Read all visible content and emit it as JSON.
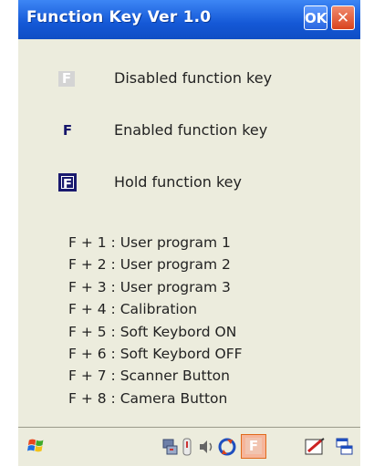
{
  "window": {
    "title": "Function Key Ver 1.0",
    "ok_label": "OK",
    "close_label": "✕"
  },
  "legend": [
    {
      "icon": "F",
      "label": "Disabled function key",
      "state": "disabled"
    },
    {
      "icon": "F",
      "label": "Enabled function key",
      "state": "enabled"
    },
    {
      "icon": "F",
      "label": "Hold function key",
      "state": "hold"
    }
  ],
  "mappings": [
    "F + 1 : User program 1",
    "F + 2 : User program 2",
    "F + 3 : User program 3",
    "F + 4 : Calibration",
    "F + 5 : Soft Keybord ON",
    "F + 6 : Soft Keybord OFF",
    "F + 7 : Scanner Button",
    "F + 8 : Camera Button"
  ],
  "taskbar": {
    "function_key_icon": "F",
    "icons": [
      "windows-start-icon",
      "network-icon",
      "connection-icon",
      "volume-icon",
      "sync-icon",
      "function-key-tray-icon",
      "input-panel-icon",
      "switch-window-icon"
    ]
  },
  "colors": {
    "titlebar": "#1458d6",
    "body_bg": "#ececdd",
    "key_enabled": "#15156b"
  }
}
